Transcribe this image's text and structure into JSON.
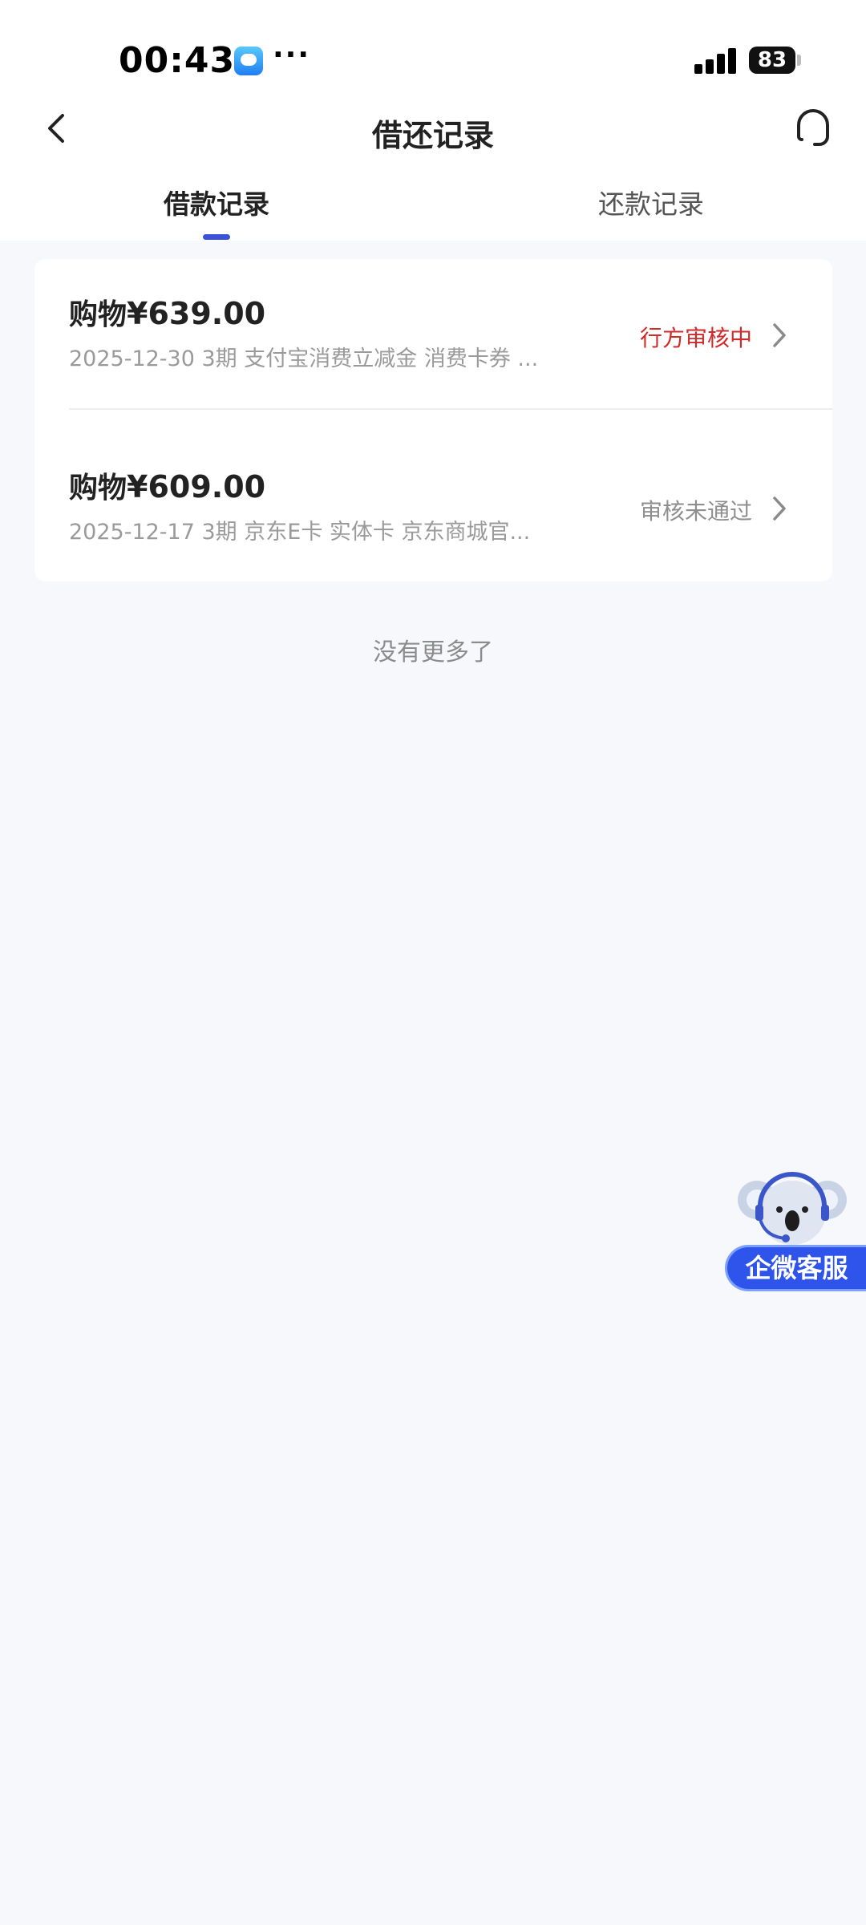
{
  "status_bar": {
    "time": "00:43",
    "more": "···",
    "battery": "83"
  },
  "nav": {
    "title": "借还记录"
  },
  "tabs": [
    {
      "label": "借款记录",
      "active": true
    },
    {
      "label": "还款记录",
      "active": false
    }
  ],
  "records": [
    {
      "amount_prefix": "购物",
      "amount": "¥639.00",
      "meta": "2025-12-30 3期  支付宝消费立减金 消费卡券 ...",
      "status": "行方审核中",
      "status_color": "#d12a2a"
    },
    {
      "amount_prefix": "购物",
      "amount": "¥609.00",
      "meta": "2025-12-17 3期  京东E卡 实体卡 京东商城官...",
      "status": "审核未通过",
      "status_color": "#8e8e8e"
    }
  ],
  "footer_text": "没有更多了",
  "floating_service": {
    "label": "企微客服",
    "color": "#2f54eb"
  },
  "accent_color": "#3a53d8"
}
